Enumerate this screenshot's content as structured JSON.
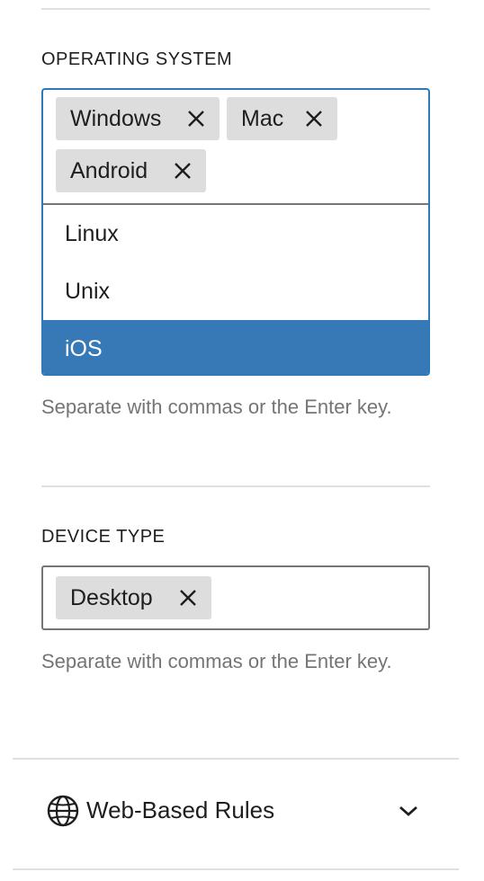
{
  "operating_system": {
    "label": "OPERATING SYSTEM",
    "tokens": [
      {
        "label": "Windows",
        "remove_icon": "close-icon"
      },
      {
        "label": "Mac",
        "remove_icon": "close-icon"
      },
      {
        "label": "Android",
        "remove_icon": "close-icon"
      }
    ],
    "suggestions": [
      {
        "label": "Linux",
        "selected": false
      },
      {
        "label": "Unix",
        "selected": false
      },
      {
        "label": "iOS",
        "selected": true
      }
    ],
    "help": "Separate with commas or the Enter key."
  },
  "device_type": {
    "label": "DEVICE TYPE",
    "tokens": [
      {
        "label": "Desktop",
        "remove_icon": "close-icon"
      }
    ],
    "help": "Separate with commas or the Enter key."
  },
  "web_based_rules": {
    "title": "Web-Based Rules",
    "icon": "globe-icon",
    "toggle_icon": "chevron-down-icon",
    "expanded": false
  },
  "colors": {
    "focus_border": "#3079b8",
    "selected_suggestion": "#3779b6",
    "token_background": "#dddddd",
    "help_text": "#757575"
  }
}
